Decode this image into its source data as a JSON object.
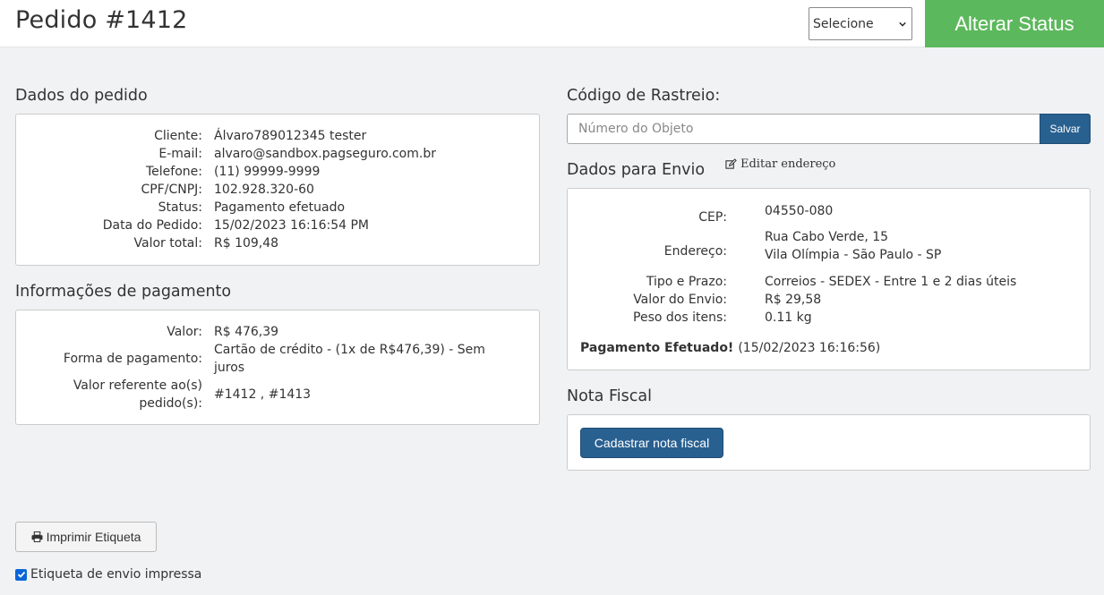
{
  "header": {
    "title": "Pedido #1412",
    "status_select_value": "Selecione",
    "alter_status_label": "Alterar Status"
  },
  "order": {
    "title": "Dados do pedido",
    "rows": [
      {
        "label": "Cliente:",
        "value": "Álvaro789012345 tester"
      },
      {
        "label": "E-mail:",
        "value": "alvaro@sandbox.pagseguro.com.br"
      },
      {
        "label": "Telefone:",
        "value": "(11) 99999-9999"
      },
      {
        "label": "CPF/CNPJ:",
        "value": "102.928.320-60"
      },
      {
        "label": "Status:",
        "value": "Pagamento efetuado"
      },
      {
        "label": "Data do Pedido:",
        "value": "15/02/2023 16:16:54 PM"
      },
      {
        "label": "Valor total:",
        "value": "R$ 109,48"
      }
    ]
  },
  "payment": {
    "title": "Informações de pagamento",
    "value_label": "Valor:",
    "value": "R$ 476,39",
    "method_label": "Forma de pagamento:",
    "method_line1": "Cartão de crédito - (1x de R$476,39) - Sem",
    "method_line2": "juros",
    "ref_label_line1": "Valor referente ao(s)",
    "ref_label_line2": "pedido(s):",
    "ref_value": "#1412 , #1413"
  },
  "tracking": {
    "title": "Código de Rastreio:",
    "placeholder": "Número do Objeto",
    "save_label": "Salvar"
  },
  "shipping": {
    "title": "Dados para Envio",
    "edit_label": "Editar endereço",
    "cep_label": "CEP:",
    "cep": "04550-080",
    "address_label": "Endereço:",
    "address_line1": "Rua Cabo Verde, 15",
    "address_line2": "Vila Olímpia - São Paulo - SP",
    "type_label": "Tipo e Prazo:",
    "type": "Correios - SEDEX - Entre 1 e 2 dias úteis",
    "ship_value_label": "Valor do Envio:",
    "ship_value": "R$ 29,58",
    "weight_label": "Peso dos itens:",
    "weight": "0.11 kg",
    "payment_done_bold": "Pagamento Efetuado!",
    "payment_done_date": "(15/02/2023 16:16:56)"
  },
  "invoice": {
    "title": "Nota Fiscal",
    "button_label": "Cadastrar nota fiscal"
  },
  "footer": {
    "print_label": "Imprimir Etiqueta",
    "printed_label": "Etiqueta de envio impressa",
    "printed_checked": true
  },
  "colors": {
    "accent_green": "#5cb85c",
    "primary_blue": "#286090",
    "link_blue": "#337ab7"
  },
  "icons": [
    "chevron-down-icon",
    "edit-icon",
    "printer-icon",
    "checkbox-checked-icon"
  ]
}
